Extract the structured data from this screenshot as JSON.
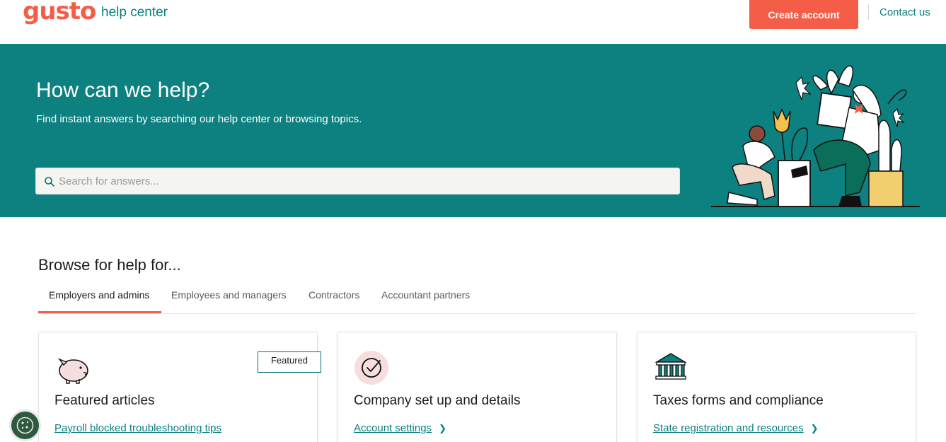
{
  "header": {
    "logo": "gusto",
    "subtitle": "help center",
    "create_account": "Create account",
    "contact": "Contact us"
  },
  "hero": {
    "title": "How can we help?",
    "subtitle": "Find instant answers by searching our help center or browsing topics.",
    "search_placeholder": "Search for answers..."
  },
  "browse": {
    "title": "Browse for help for...",
    "tabs": [
      {
        "label": "Employers and admins",
        "active": true
      },
      {
        "label": "Employees and managers",
        "active": false
      },
      {
        "label": "Contractors",
        "active": false
      },
      {
        "label": "Accountant partners",
        "active": false
      }
    ]
  },
  "cards": [
    {
      "icon": "piggy-bank-icon",
      "title": "Featured articles",
      "badge": "Featured",
      "link": "Payroll blocked troubleshooting tips"
    },
    {
      "icon": "checkmark-circle-icon",
      "title": "Company set up and details",
      "link": "Account settings"
    },
    {
      "icon": "government-building-icon",
      "title": "Taxes forms and compliance",
      "link": "State registration and resources"
    }
  ],
  "colors": {
    "brand": "#f45d48",
    "teal": "#0d8080",
    "link": "#0a8080"
  }
}
